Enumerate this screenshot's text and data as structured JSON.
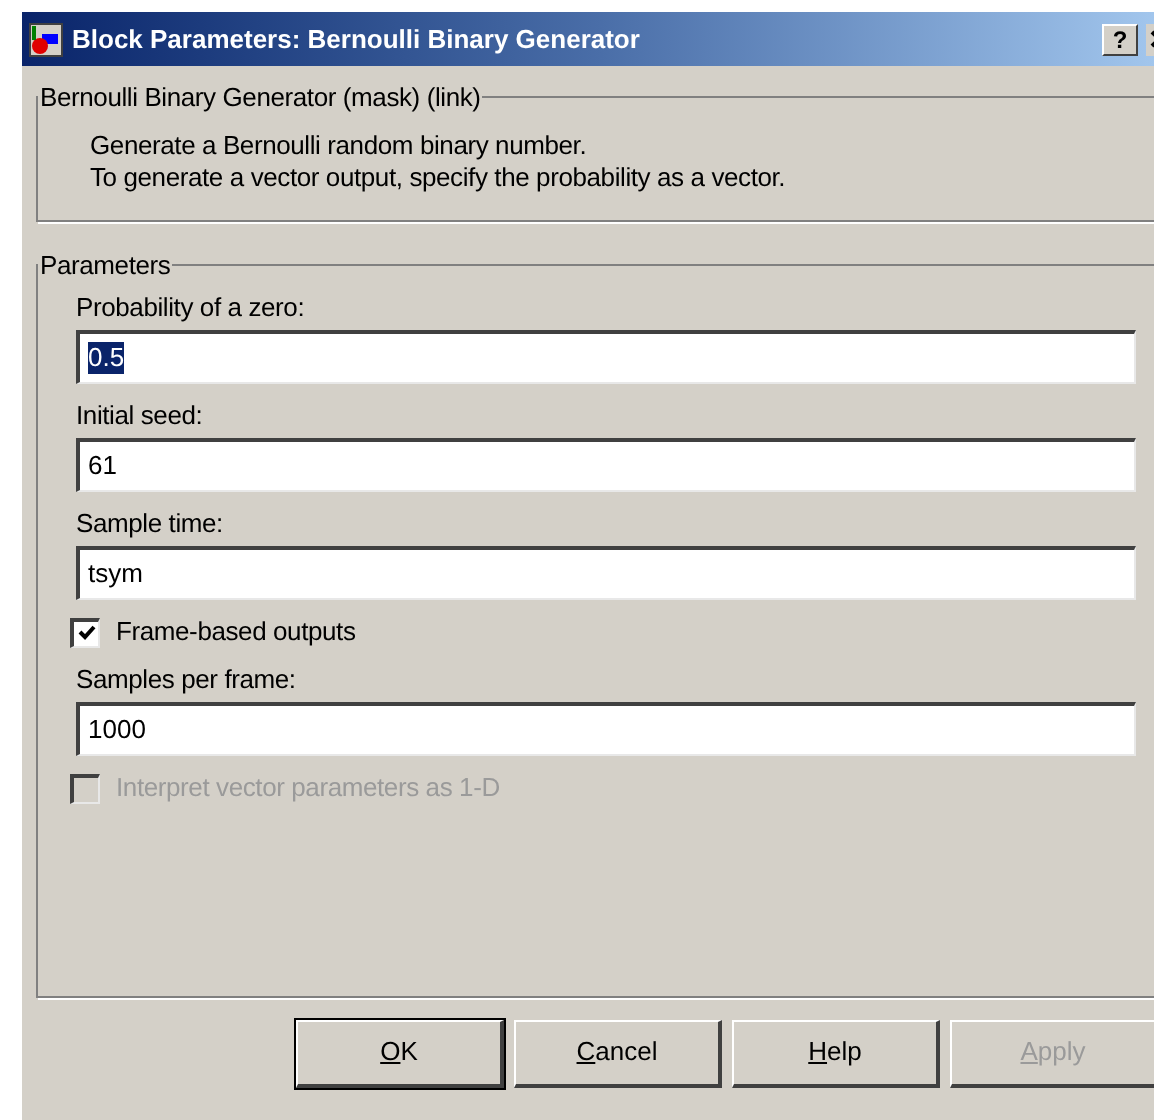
{
  "window": {
    "title": "Block Parameters: Bernoulli Binary Generator",
    "help_button": "?"
  },
  "description_group": {
    "title": "Bernoulli Binary Generator (mask) (link)",
    "lines": [
      "Generate a Bernoulli random binary number.",
      "To generate a vector output, specify the probability as a vector."
    ]
  },
  "parameters_group": {
    "title": "Parameters",
    "items": [
      {
        "kind": "field",
        "label": "Probability of a zero:",
        "value": "0.5",
        "value_selected": true
      },
      {
        "kind": "field",
        "label": "Initial seed:",
        "value": "61",
        "value_selected": false
      },
      {
        "kind": "field",
        "label": "Sample time:",
        "value": "tsym",
        "value_selected": false
      },
      {
        "kind": "checkbox",
        "label": "Frame-based outputs",
        "checked": true,
        "disabled": false
      },
      {
        "kind": "field",
        "label": "Samples per frame:",
        "value": "1000",
        "value_selected": false
      },
      {
        "kind": "checkbox",
        "label": "Interpret vector parameters as 1-D",
        "checked": false,
        "disabled": true
      }
    ]
  },
  "buttons": [
    {
      "label": "OK",
      "default": true,
      "disabled": false
    },
    {
      "label": "Cancel",
      "default": false,
      "disabled": false
    },
    {
      "label": "Help",
      "default": false,
      "disabled": false
    },
    {
      "label": "Apply",
      "default": false,
      "disabled": true
    }
  ]
}
